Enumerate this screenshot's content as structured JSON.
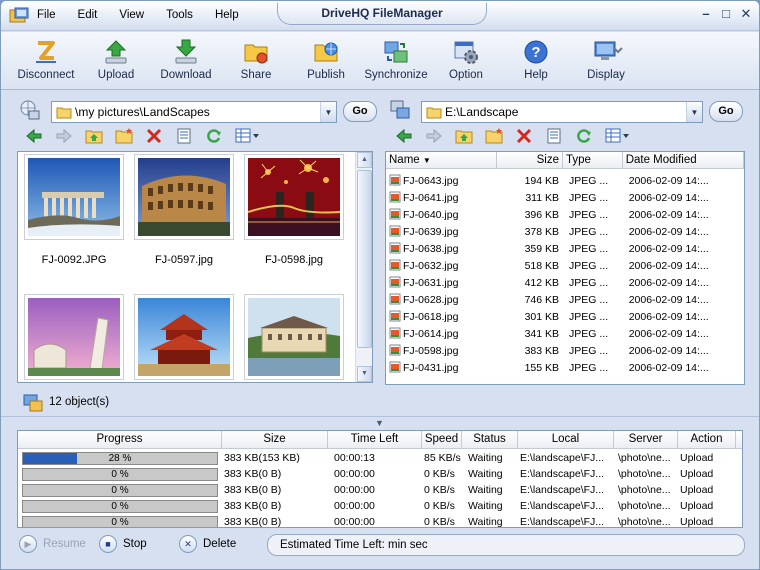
{
  "app": {
    "title": "DriveHQ FileManager",
    "menu": [
      "File",
      "Edit",
      "View",
      "Tools",
      "Help"
    ],
    "window_buttons": [
      "–",
      "□",
      "✕"
    ]
  },
  "toolbar": {
    "items": [
      {
        "label": "Disconnect",
        "icon": "disconnect-icon"
      },
      {
        "label": "Upload",
        "icon": "upload-icon"
      },
      {
        "label": "Download",
        "icon": "download-icon"
      },
      {
        "label": "Share",
        "icon": "share-icon"
      },
      {
        "label": "Publish",
        "icon": "publish-icon"
      },
      {
        "label": "Synchronize",
        "icon": "synchronize-icon"
      },
      {
        "label": "Option",
        "icon": "option-icon"
      },
      {
        "label": "Help",
        "icon": "help-icon"
      },
      {
        "label": "Display",
        "icon": "display-icon"
      }
    ]
  },
  "left_pane": {
    "path": "\\my pictures\\LandScapes",
    "go_label": "Go",
    "thumbnails": [
      {
        "caption": "FJ-0092.JPG",
        "scene": "ruins"
      },
      {
        "caption": "FJ-0597.jpg",
        "scene": "colosseum"
      },
      {
        "caption": "FJ-0598.jpg",
        "scene": "fireworks-bridge"
      },
      {
        "caption": "",
        "scene": "leaning-tower"
      },
      {
        "caption": "",
        "scene": "pagoda"
      },
      {
        "caption": "",
        "scene": "palace"
      }
    ]
  },
  "right_pane": {
    "path": "E:\\Landscape",
    "go_label": "Go",
    "columns": [
      "Name",
      "Size",
      "Type",
      "Date Modified"
    ],
    "files": [
      {
        "name": "FJ-0643.jpg",
        "size": "194 KB",
        "type": "JPEG ...",
        "date": "2006-02-09 14:..."
      },
      {
        "name": "FJ-0641.jpg",
        "size": "311 KB",
        "type": "JPEG ...",
        "date": "2006-02-09 14:..."
      },
      {
        "name": "FJ-0640.jpg",
        "size": "396 KB",
        "type": "JPEG ...",
        "date": "2006-02-09 14:..."
      },
      {
        "name": "FJ-0639.jpg",
        "size": "378 KB",
        "type": "JPEG ...",
        "date": "2006-02-09 14:..."
      },
      {
        "name": "FJ-0638.jpg",
        "size": "359 KB",
        "type": "JPEG ...",
        "date": "2006-02-09 14:..."
      },
      {
        "name": "FJ-0632.jpg",
        "size": "518 KB",
        "type": "JPEG ...",
        "date": "2006-02-09 14:..."
      },
      {
        "name": "FJ-0631.jpg",
        "size": "412 KB",
        "type": "JPEG ...",
        "date": "2006-02-09 14:..."
      },
      {
        "name": "FJ-0628.jpg",
        "size": "746 KB",
        "type": "JPEG ...",
        "date": "2006-02-09 14:..."
      },
      {
        "name": "FJ-0618.jpg",
        "size": "301 KB",
        "type": "JPEG ...",
        "date": "2006-02-09 14:..."
      },
      {
        "name": "FJ-0614.jpg",
        "size": "341 KB",
        "type": "JPEG ...",
        "date": "2006-02-09 14:..."
      },
      {
        "name": "FJ-0598.jpg",
        "size": "383 KB",
        "type": "JPEG ...",
        "date": "2006-02-09 14:..."
      },
      {
        "name": "FJ-0431.jpg",
        "size": "155 KB",
        "type": "JPEG ...",
        "date": "2006-02-09 14:..."
      }
    ]
  },
  "status": {
    "objects": "12 object(s)"
  },
  "transfers": {
    "columns": [
      "Progress",
      "Size",
      "Time Left",
      "Speed",
      "Status",
      "Local",
      "Server",
      "Action"
    ],
    "rows": [
      {
        "progress": 28,
        "progress_text": "28 %",
        "size": "383 KB(153 KB)",
        "time_left": "00:00:13",
        "speed": "85 KB/s",
        "status": "Waiting",
        "local": "E:\\landscape\\FJ...",
        "server": "\\photo\\ne...",
        "action": "Upload"
      },
      {
        "progress": 0,
        "progress_text": "0 %",
        "size": "383 KB(0 B)",
        "time_left": "00:00:00",
        "speed": "0 KB/s",
        "status": "Waiting",
        "local": "E:\\landscape\\FJ...",
        "server": "\\photo\\ne...",
        "action": "Upload"
      },
      {
        "progress": 0,
        "progress_text": "0 %",
        "size": "383 KB(0 B)",
        "time_left": "00:00:00",
        "speed": "0 KB/s",
        "status": "Waiting",
        "local": "E:\\landscape\\FJ...",
        "server": "\\photo\\ne...",
        "action": "Upload"
      },
      {
        "progress": 0,
        "progress_text": "0 %",
        "size": "383 KB(0 B)",
        "time_left": "00:00:00",
        "speed": "0 KB/s",
        "status": "Waiting",
        "local": "E:\\landscape\\FJ...",
        "server": "\\photo\\ne...",
        "action": "Upload"
      },
      {
        "progress": 0,
        "progress_text": "0 %",
        "size": "383 KB(0 B)",
        "time_left": "00:00:00",
        "speed": "0 KB/s",
        "status": "Waiting",
        "local": "E:\\landscape\\FJ...",
        "server": "\\photo\\ne...",
        "action": "Upload"
      }
    ]
  },
  "controls": {
    "resume": "Resume",
    "stop": "Stop",
    "delete": "Delete",
    "estimated": "Estimated Time Left: min sec"
  },
  "colors": {
    "progress_fill": "#2a5fb8",
    "accent": "#7f9db9"
  }
}
